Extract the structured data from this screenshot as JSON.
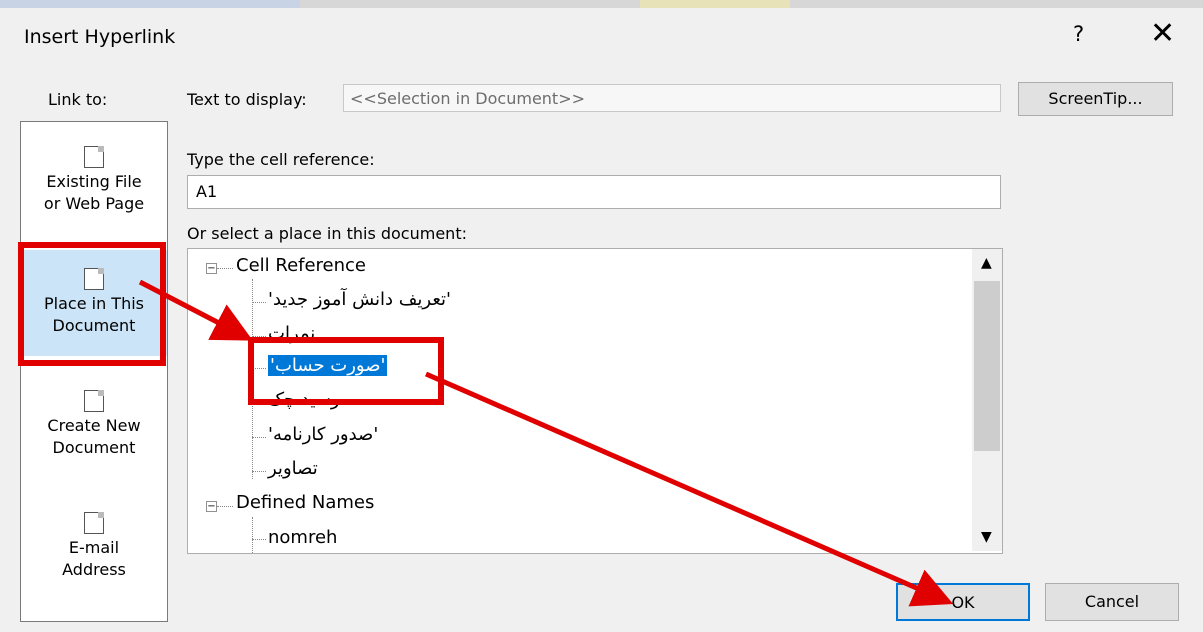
{
  "dialog": {
    "title": "Insert Hyperlink",
    "help_label": "?",
    "close_label": "✕"
  },
  "link_to": {
    "label": "Link to:",
    "items": [
      {
        "line1": "Existing File",
        "line2": "or Web Page"
      },
      {
        "line1": "Place in This",
        "line2": "Document"
      },
      {
        "line1": "Create New",
        "line2": "Document"
      },
      {
        "line1": "E-mail",
        "line2": "Address"
      }
    ]
  },
  "text_to_display": {
    "label": "Text to display:",
    "value": "<<Selection in Document>>"
  },
  "screentip_label": "ScreenTip...",
  "cell_reference": {
    "label": "Type the cell reference:",
    "value": "A1"
  },
  "place_list": {
    "label": "Or select a place in this document:",
    "groups": [
      {
        "name": "Cell Reference",
        "items": [
          "'تعریف دانش آموز جدید'",
          "نمرات",
          "'صورت حساب'",
          "رسید چک",
          "'صدور کارنامه'",
          "تصاویر"
        ]
      },
      {
        "name": "Defined Names",
        "items": [
          "nomreh"
        ]
      }
    ],
    "selected": "'صورت حساب'"
  },
  "buttons": {
    "ok": "OK",
    "cancel": "Cancel"
  },
  "colors": {
    "highlight": "#e00000",
    "selection": "#0078d7"
  }
}
